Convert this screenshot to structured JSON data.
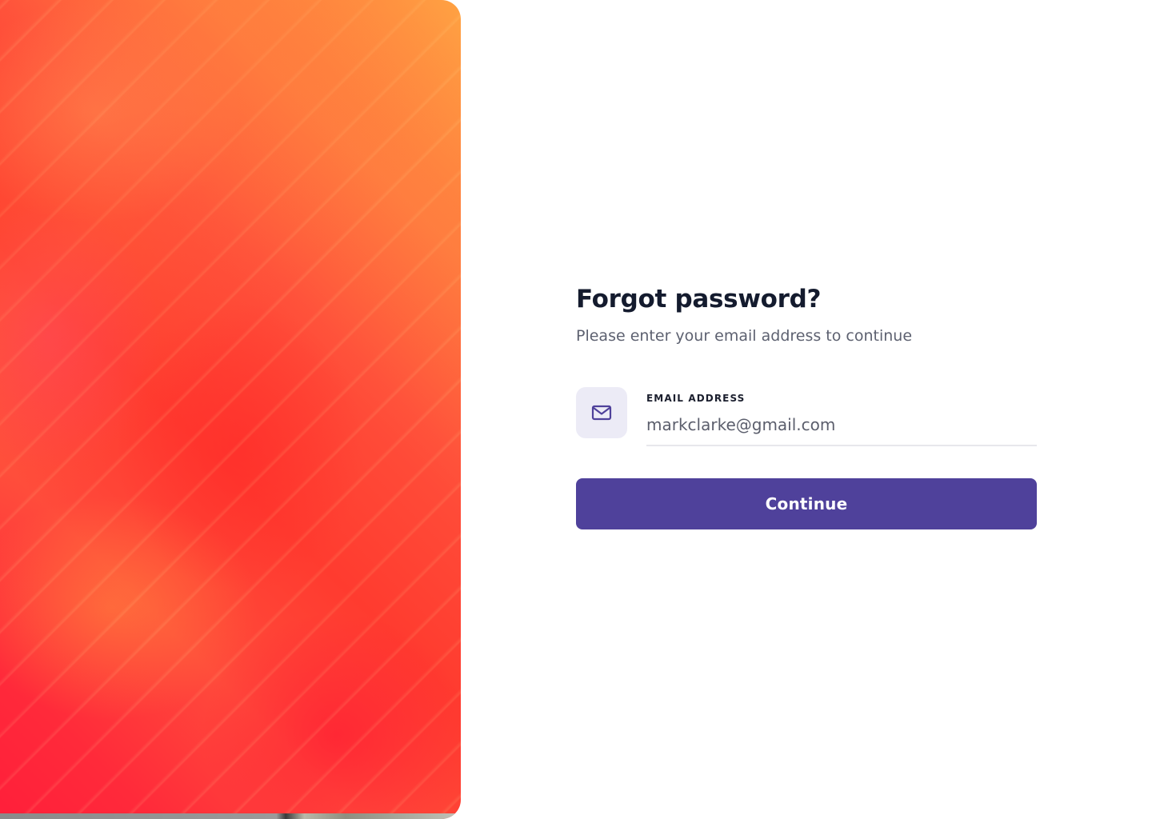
{
  "hero": {
    "description": ""
  },
  "form": {
    "title": "Forgot password?",
    "subtitle": "Please enter your email address to continue",
    "email": {
      "label": "EMAIL ADDRESS",
      "value": "markclarke@gmail.com",
      "icon": "mail-icon"
    },
    "continue_label": "Continue"
  },
  "colors": {
    "accent": "#4f419b",
    "icon_bg": "#ecebf6",
    "title": "#141b2e",
    "subtitle": "#5d6170"
  }
}
